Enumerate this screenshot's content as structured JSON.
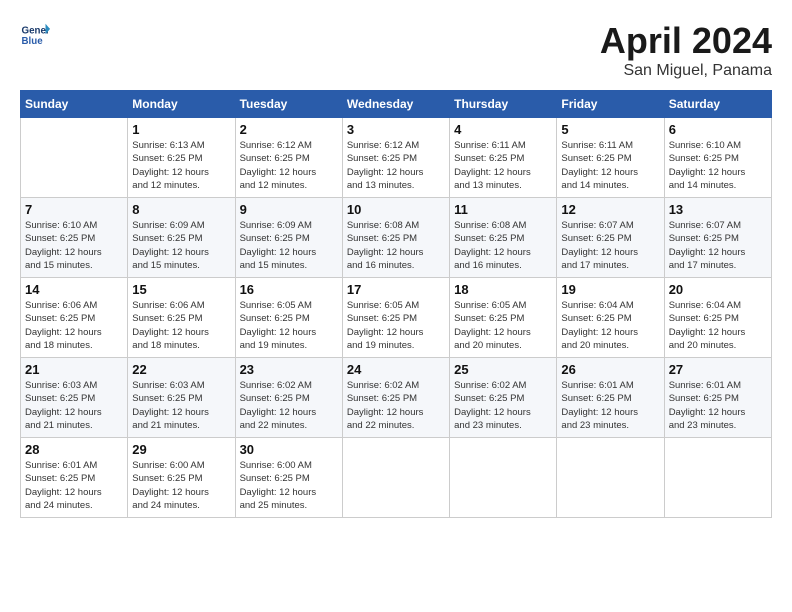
{
  "logo": {
    "line1": "General",
    "line2": "Blue"
  },
  "title": "April 2024",
  "subtitle": "San Miguel, Panama",
  "days_header": [
    "Sunday",
    "Monday",
    "Tuesday",
    "Wednesday",
    "Thursday",
    "Friday",
    "Saturday"
  ],
  "weeks": [
    [
      {
        "day": "",
        "info": ""
      },
      {
        "day": "1",
        "info": "Sunrise: 6:13 AM\nSunset: 6:25 PM\nDaylight: 12 hours\nand 12 minutes."
      },
      {
        "day": "2",
        "info": "Sunrise: 6:12 AM\nSunset: 6:25 PM\nDaylight: 12 hours\nand 12 minutes."
      },
      {
        "day": "3",
        "info": "Sunrise: 6:12 AM\nSunset: 6:25 PM\nDaylight: 12 hours\nand 13 minutes."
      },
      {
        "day": "4",
        "info": "Sunrise: 6:11 AM\nSunset: 6:25 PM\nDaylight: 12 hours\nand 13 minutes."
      },
      {
        "day": "5",
        "info": "Sunrise: 6:11 AM\nSunset: 6:25 PM\nDaylight: 12 hours\nand 14 minutes."
      },
      {
        "day": "6",
        "info": "Sunrise: 6:10 AM\nSunset: 6:25 PM\nDaylight: 12 hours\nand 14 minutes."
      }
    ],
    [
      {
        "day": "7",
        "info": "Sunrise: 6:10 AM\nSunset: 6:25 PM\nDaylight: 12 hours\nand 15 minutes."
      },
      {
        "day": "8",
        "info": "Sunrise: 6:09 AM\nSunset: 6:25 PM\nDaylight: 12 hours\nand 15 minutes."
      },
      {
        "day": "9",
        "info": "Sunrise: 6:09 AM\nSunset: 6:25 PM\nDaylight: 12 hours\nand 15 minutes."
      },
      {
        "day": "10",
        "info": "Sunrise: 6:08 AM\nSunset: 6:25 PM\nDaylight: 12 hours\nand 16 minutes."
      },
      {
        "day": "11",
        "info": "Sunrise: 6:08 AM\nSunset: 6:25 PM\nDaylight: 12 hours\nand 16 minutes."
      },
      {
        "day": "12",
        "info": "Sunrise: 6:07 AM\nSunset: 6:25 PM\nDaylight: 12 hours\nand 17 minutes."
      },
      {
        "day": "13",
        "info": "Sunrise: 6:07 AM\nSunset: 6:25 PM\nDaylight: 12 hours\nand 17 minutes."
      }
    ],
    [
      {
        "day": "14",
        "info": "Sunrise: 6:06 AM\nSunset: 6:25 PM\nDaylight: 12 hours\nand 18 minutes."
      },
      {
        "day": "15",
        "info": "Sunrise: 6:06 AM\nSunset: 6:25 PM\nDaylight: 12 hours\nand 18 minutes."
      },
      {
        "day": "16",
        "info": "Sunrise: 6:05 AM\nSunset: 6:25 PM\nDaylight: 12 hours\nand 19 minutes."
      },
      {
        "day": "17",
        "info": "Sunrise: 6:05 AM\nSunset: 6:25 PM\nDaylight: 12 hours\nand 19 minutes."
      },
      {
        "day": "18",
        "info": "Sunrise: 6:05 AM\nSunset: 6:25 PM\nDaylight: 12 hours\nand 20 minutes."
      },
      {
        "day": "19",
        "info": "Sunrise: 6:04 AM\nSunset: 6:25 PM\nDaylight: 12 hours\nand 20 minutes."
      },
      {
        "day": "20",
        "info": "Sunrise: 6:04 AM\nSunset: 6:25 PM\nDaylight: 12 hours\nand 20 minutes."
      }
    ],
    [
      {
        "day": "21",
        "info": "Sunrise: 6:03 AM\nSunset: 6:25 PM\nDaylight: 12 hours\nand 21 minutes."
      },
      {
        "day": "22",
        "info": "Sunrise: 6:03 AM\nSunset: 6:25 PM\nDaylight: 12 hours\nand 21 minutes."
      },
      {
        "day": "23",
        "info": "Sunrise: 6:02 AM\nSunset: 6:25 PM\nDaylight: 12 hours\nand 22 minutes."
      },
      {
        "day": "24",
        "info": "Sunrise: 6:02 AM\nSunset: 6:25 PM\nDaylight: 12 hours\nand 22 minutes."
      },
      {
        "day": "25",
        "info": "Sunrise: 6:02 AM\nSunset: 6:25 PM\nDaylight: 12 hours\nand 23 minutes."
      },
      {
        "day": "26",
        "info": "Sunrise: 6:01 AM\nSunset: 6:25 PM\nDaylight: 12 hours\nand 23 minutes."
      },
      {
        "day": "27",
        "info": "Sunrise: 6:01 AM\nSunset: 6:25 PM\nDaylight: 12 hours\nand 23 minutes."
      }
    ],
    [
      {
        "day": "28",
        "info": "Sunrise: 6:01 AM\nSunset: 6:25 PM\nDaylight: 12 hours\nand 24 minutes."
      },
      {
        "day": "29",
        "info": "Sunrise: 6:00 AM\nSunset: 6:25 PM\nDaylight: 12 hours\nand 24 minutes."
      },
      {
        "day": "30",
        "info": "Sunrise: 6:00 AM\nSunset: 6:25 PM\nDaylight: 12 hours\nand 25 minutes."
      },
      {
        "day": "",
        "info": ""
      },
      {
        "day": "",
        "info": ""
      },
      {
        "day": "",
        "info": ""
      },
      {
        "day": "",
        "info": ""
      }
    ]
  ]
}
